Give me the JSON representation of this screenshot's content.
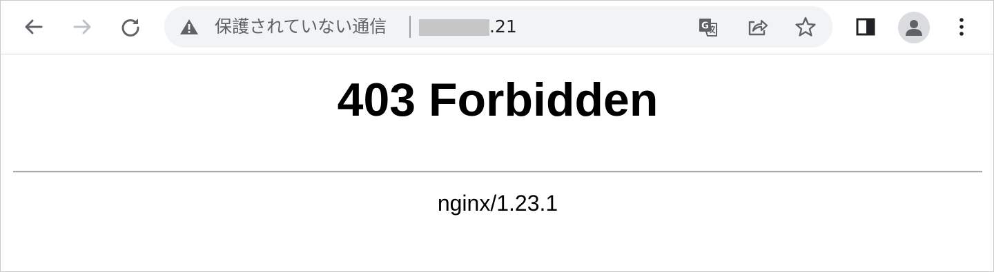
{
  "toolbar": {
    "icons": {
      "back": "arrow-left-icon",
      "forward": "arrow-right-icon",
      "reload": "reload-icon",
      "translate": "translate-icon",
      "share": "share-icon",
      "bookmark": "star-icon",
      "side_panel": "side-panel-icon",
      "profile": "person-icon",
      "menu": "kebab-menu-icon"
    },
    "forward_enabled": false
  },
  "omnibox": {
    "security_icon": "warning-triangle-icon",
    "security_label": "保護されていない通信",
    "url_visible_suffix": ".21",
    "url_host_redacted": true
  },
  "page": {
    "title": "403 Forbidden",
    "server_signature": "nginx/1.23.1"
  },
  "colors": {
    "icon_active": "#5f6368",
    "icon_disabled": "#bdc1c6",
    "omnibox_bg": "#f1f3f4",
    "avatar_bg": "#dadce0",
    "redaction": "#c6c6c6"
  }
}
